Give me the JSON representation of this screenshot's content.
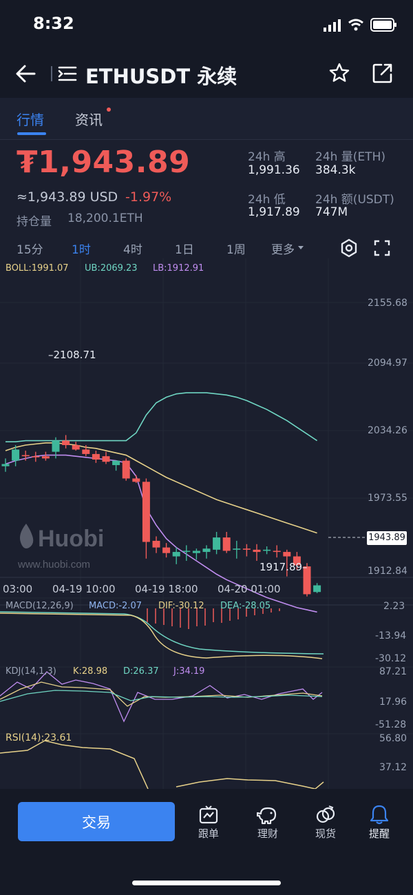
{
  "status_bar": {
    "time": "8:32"
  },
  "header": {
    "title": "ETHUSDT 永续"
  },
  "tabs": [
    {
      "label": "行情",
      "active": true
    },
    {
      "label": "资讯",
      "active": false,
      "has_dot": true
    }
  ],
  "ticker": {
    "price": "₮1,943.89",
    "usd_approx": "≈1,943.89 USD",
    "change_pct": "-1.97%",
    "open_interest_label": "持仓量",
    "open_interest_value": "18,200.1ETH"
  },
  "stats": {
    "high_label": "24h 高",
    "high_value": "1,991.36",
    "low_label": "24h 低",
    "low_value": "1,917.89",
    "vol_label": "24h 量(ETH)",
    "vol_value": "384.3k",
    "amt_label": "24h 额(USDT)",
    "amt_value": "747M"
  },
  "intervals": [
    {
      "label": "15分",
      "active": false
    },
    {
      "label": "1时",
      "active": true
    },
    {
      "label": "4时",
      "active": false
    },
    {
      "label": "1日",
      "active": false
    },
    {
      "label": "1周",
      "active": false
    },
    {
      "label": "更多",
      "active": false
    }
  ],
  "indicators": {
    "boll": "BOLL:1991.07",
    "ub": "UB:2069.23",
    "lb": "LB:1912.91",
    "macd_name": "MACD(12,26,9)",
    "macd": "MACD:-2.07",
    "dif": "DIF:-30.12",
    "dea": "DEA:-28.05",
    "kdj_name": "KDJ(14,1,3)",
    "k": "K:28.98",
    "d": "D:26.37",
    "j": "J:34.19",
    "rsi": "RSI(14):23.61"
  },
  "price_axis": [
    "2155.68",
    "2094.97",
    "2034.26",
    "1973.55",
    "1912.84"
  ],
  "current_price_tag": "1943.89",
  "annotations": {
    "high": "2108.71",
    "low": "1917.89"
  },
  "time_axis": [
    "03:00",
    "04-19 10:00",
    "04-19 18:00",
    "04-20 01:00"
  ],
  "macd_axis": [
    "2.23",
    "-13.94",
    "-30.12"
  ],
  "kdj_axis": [
    "87.21",
    "17.96",
    "-51.28"
  ],
  "rsi_axis": [
    "56.80",
    "37.12"
  ],
  "watermark": {
    "brand": "Huobi",
    "url": "www.huobi.com"
  },
  "bottom_nav": {
    "trade": "交易",
    "items": [
      {
        "label": "跟单",
        "icon": "copy-trade-icon"
      },
      {
        "label": "理财",
        "icon": "piggy-bank-icon"
      },
      {
        "label": "现货",
        "icon": "spot-icon"
      },
      {
        "label": "提醒",
        "icon": "bell-icon",
        "active": true
      }
    ]
  },
  "colors": {
    "up": "#3fb89b",
    "down": "#ef5b58",
    "accent": "#3b83f0",
    "boll_mid": "#e8d28a",
    "boll_ub": "#6fd6c3",
    "boll_lb": "#c08df0"
  },
  "chart_data": {
    "type": "candlestick",
    "ylim": [
      1905,
      2165
    ],
    "candles": [
      {
        "o": 2003,
        "h": 2010,
        "l": 1998,
        "c": 2005
      },
      {
        "o": 2008,
        "h": 2022,
        "l": 2003,
        "c": 2018
      },
      {
        "o": 2013,
        "h": 2017,
        "l": 2008,
        "c": 2012
      },
      {
        "o": 2012,
        "h": 2016,
        "l": 2007,
        "c": 2011
      },
      {
        "o": 2012,
        "h": 2016,
        "l": 2008,
        "c": 2010
      },
      {
        "o": 2016,
        "h": 2029,
        "l": 2010,
        "c": 2026
      },
      {
        "o": 2026,
        "h": 2031,
        "l": 2019,
        "c": 2022
      },
      {
        "o": 2022,
        "h": 2025,
        "l": 2017,
        "c": 2018
      },
      {
        "o": 2018,
        "h": 2022,
        "l": 2012,
        "c": 2014
      },
      {
        "o": 2014,
        "h": 2017,
        "l": 2006,
        "c": 2009
      },
      {
        "o": 2012,
        "h": 2016,
        "l": 2005,
        "c": 2007
      },
      {
        "o": 2004,
        "h": 2008,
        "l": 1999,
        "c": 2008
      },
      {
        "o": 2008,
        "h": 2010,
        "l": 1990,
        "c": 1992
      },
      {
        "o": 1992,
        "h": 1995,
        "l": 1988,
        "c": 1989
      },
      {
        "o": 1989,
        "h": 1992,
        "l": 1920,
        "c": 1935
      },
      {
        "o": 1936,
        "h": 1940,
        "l": 1925,
        "c": 1930
      },
      {
        "o": 1930,
        "h": 1934,
        "l": 1921,
        "c": 1925
      },
      {
        "o": 1922,
        "h": 1930,
        "l": 1915,
        "c": 1926
      },
      {
        "o": 1927,
        "h": 1932,
        "l": 1918,
        "c": 1927
      },
      {
        "o": 1925,
        "h": 1929,
        "l": 1919,
        "c": 1927
      },
      {
        "o": 1926,
        "h": 1932,
        "l": 1920,
        "c": 1929
      },
      {
        "o": 1928,
        "h": 1944,
        "l": 1924,
        "c": 1939
      },
      {
        "o": 1939,
        "h": 1944,
        "l": 1925,
        "c": 1927
      },
      {
        "o": 1928,
        "h": 1936,
        "l": 1920,
        "c": 1929
      },
      {
        "o": 1929,
        "h": 1933,
        "l": 1922,
        "c": 1928
      },
      {
        "o": 1928,
        "h": 1933,
        "l": 1918,
        "c": 1926
      },
      {
        "o": 1927,
        "h": 1931,
        "l": 1924,
        "c": 1928
      },
      {
        "o": 1927,
        "h": 1932,
        "l": 1921,
        "c": 1926
      },
      {
        "o": 1926,
        "h": 1928,
        "l": 1904,
        "c": 1922
      },
      {
        "o": 1922,
        "h": 1926,
        "l": 1910,
        "c": 1914
      },
      {
        "o": 1913,
        "h": 1916,
        "l": 1886,
        "c": 1888
      },
      {
        "o": 1890,
        "h": 1898,
        "l": 1889,
        "c": 1896
      }
    ],
    "boll_mid": [
      2017,
      2020,
      2022,
      2023,
      2024,
      2024,
      2023,
      2022,
      2020,
      2019,
      2017,
      2015,
      2013,
      2008,
      2003,
      1998,
      1993,
      1989,
      1985,
      1981,
      1977,
      1973,
      1970,
      1967,
      1964,
      1961,
      1958,
      1955,
      1952,
      1949,
      1946,
      1943
    ],
    "boll_ub": [
      2025,
      2025,
      2026,
      2026,
      2026,
      2026,
      2026,
      2026,
      2026,
      2026,
      2026,
      2026,
      2026,
      2033,
      2049,
      2060,
      2065,
      2068,
      2069,
      2069,
      2069,
      2068,
      2067,
      2065,
      2062,
      2058,
      2054,
      2049,
      2044,
      2038,
      2032,
      2026
    ],
    "boll_lb": [
      2005,
      2008,
      2010,
      2012,
      2013,
      2013,
      2013,
      2012,
      2011,
      2010,
      2009,
      2008,
      2006,
      1994,
      1965,
      1950,
      1938,
      1930,
      1924,
      1918,
      1912,
      1906,
      1901,
      1897,
      1893,
      1889,
      1885,
      1882,
      1879,
      1876,
      1874,
      1872
    ]
  }
}
